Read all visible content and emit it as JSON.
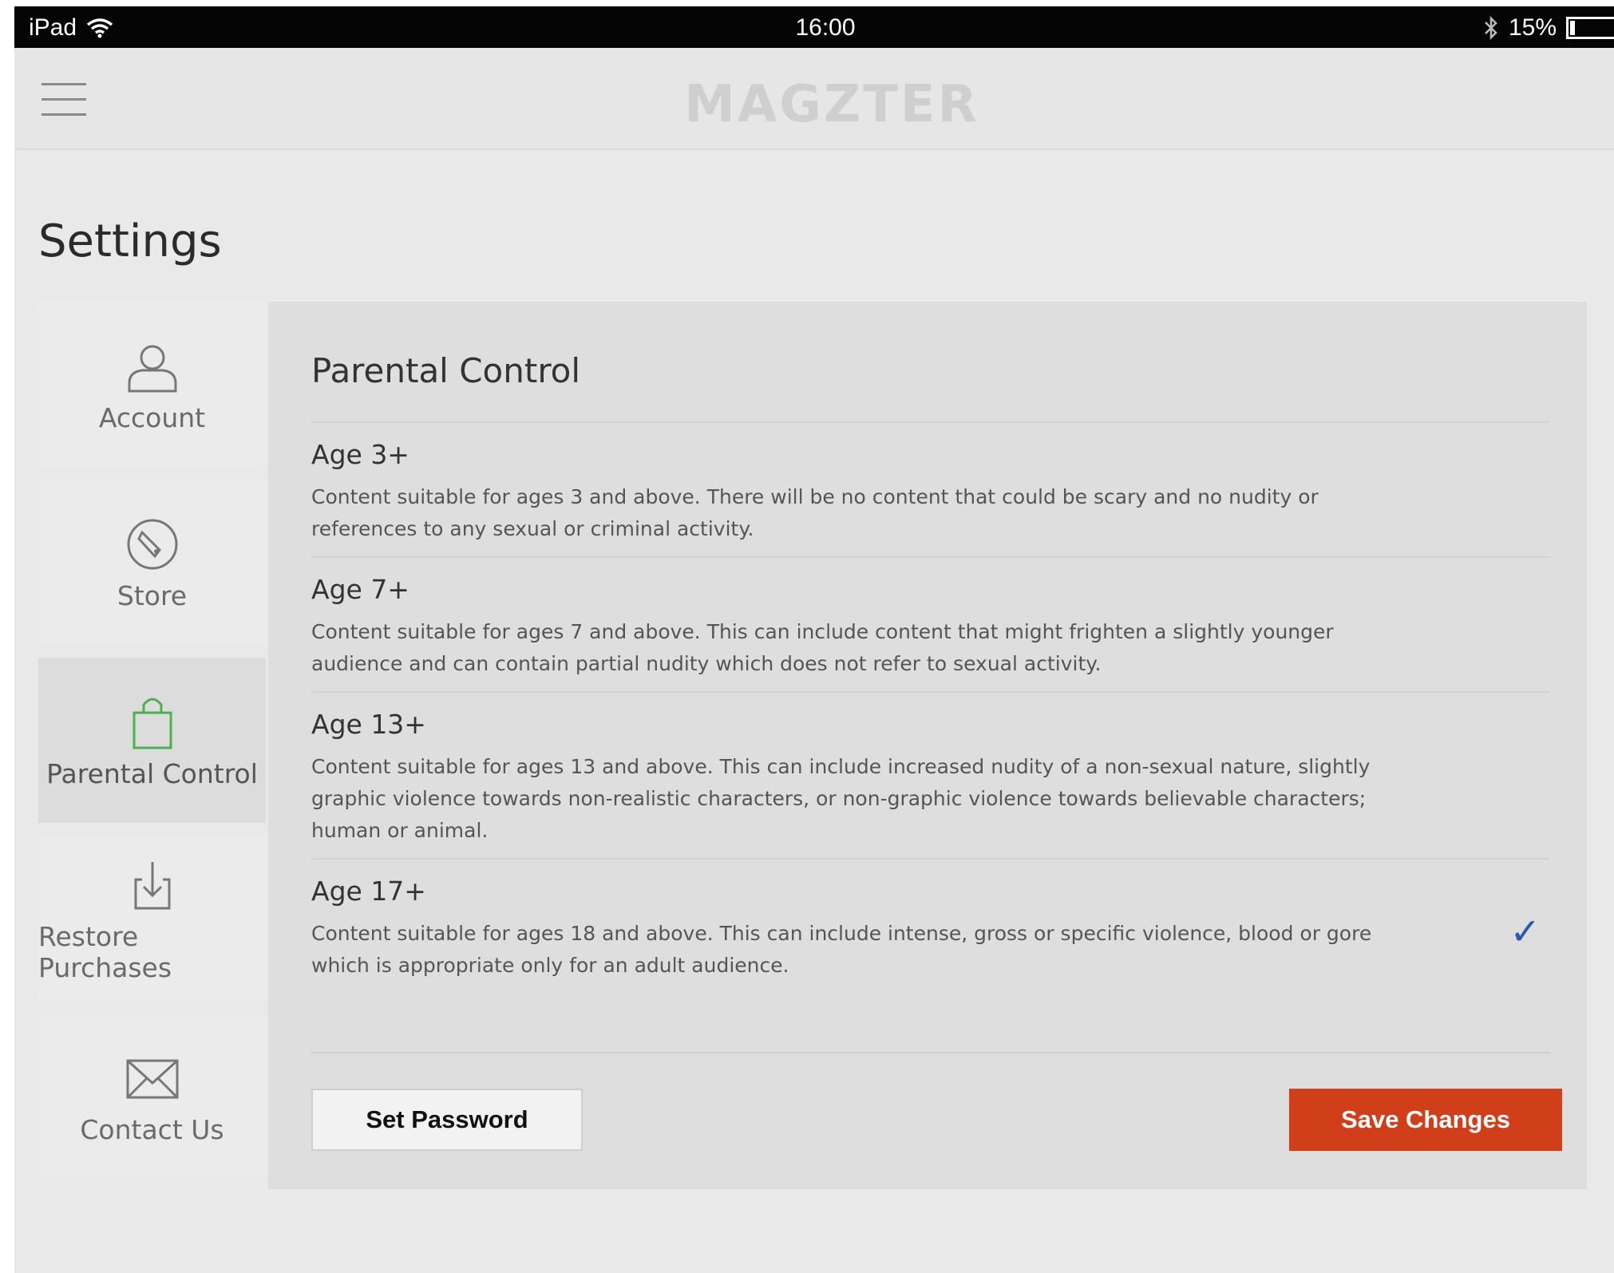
{
  "status_bar": {
    "device": "iPad",
    "time": "16:00",
    "battery": "15%"
  },
  "nav": {
    "logo": "MAGZTER"
  },
  "page": {
    "title": "Settings"
  },
  "sidebar": {
    "items": [
      {
        "label": "Account",
        "icon": "user-icon"
      },
      {
        "label": "Store",
        "icon": "store-icon"
      },
      {
        "label": "Parental Control",
        "icon": "lock-icon",
        "active": true
      },
      {
        "label": "Restore Purchases",
        "icon": "download-icon"
      },
      {
        "label": "Contact Us",
        "icon": "envelope-icon"
      }
    ]
  },
  "parental": {
    "title": "Parental Control",
    "options": [
      {
        "title": "Age 3+",
        "desc": "Content suitable for ages 3 and above. There will be no content that could be scary and no nudity or references to any sexual or criminal activity."
      },
      {
        "title": "Age 7+",
        "desc": "Content suitable for ages 7 and above. This can include content that might frighten a slightly younger audience and can contain partial nudity which does not refer to sexual activity."
      },
      {
        "title": "Age 13+",
        "desc": "Content suitable for ages 13 and above. This can include increased nudity of a non-sexual nature, slightly graphic violence towards non-realistic characters, or non-graphic violence towards believable characters; human or animal."
      },
      {
        "title": "Age 17+",
        "desc": "Content suitable for ages 18 and above. This can include intense, gross or specific violence, blood or gore which is appropriate only for an adult audience.",
        "selected": true,
        "check": "✓"
      }
    ],
    "set_password_label": "Set Password",
    "save_label": "Save Changes"
  },
  "colors": {
    "accent_save": "#d13e1a",
    "check": "#2d5aa8",
    "active_icon": "#4caf50"
  }
}
